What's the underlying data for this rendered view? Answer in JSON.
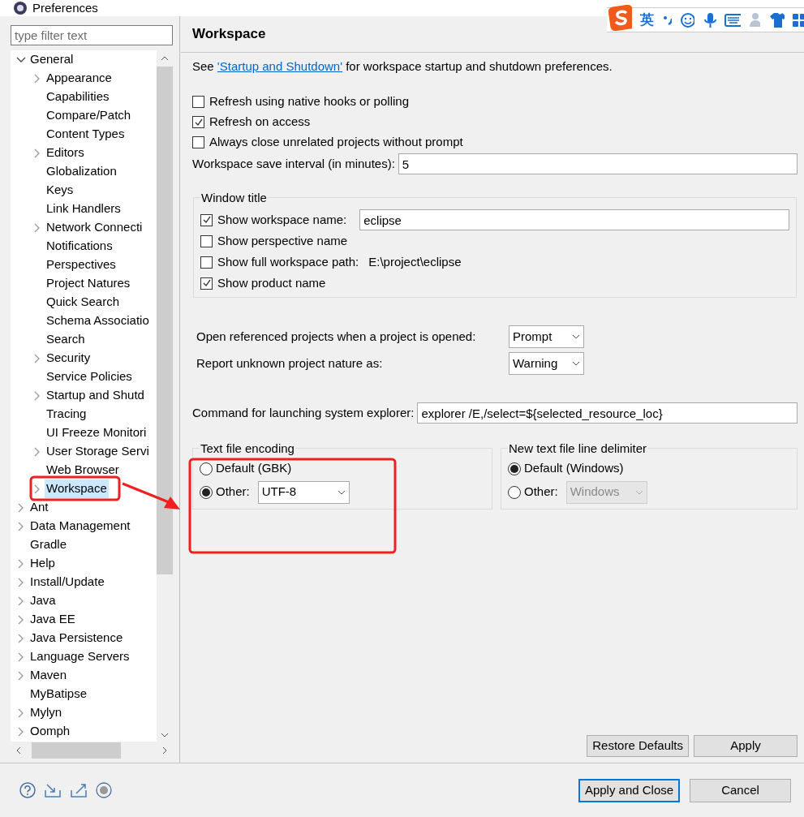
{
  "window": {
    "title": "Preferences"
  },
  "filter": {
    "placeholder": "type filter text"
  },
  "tree": [
    {
      "label": "General",
      "expandable": true,
      "expanded": true,
      "selected": false,
      "children": [
        {
          "label": "Appearance",
          "expandable": true,
          "expanded": false,
          "selected": false
        },
        {
          "label": "Capabilities",
          "expandable": false,
          "selected": false
        },
        {
          "label": "Compare/Patch",
          "expandable": false,
          "selected": false
        },
        {
          "label": "Content Types",
          "expandable": false,
          "selected": false
        },
        {
          "label": "Editors",
          "expandable": true,
          "expanded": false,
          "selected": false
        },
        {
          "label": "Globalization",
          "expandable": false,
          "selected": false
        },
        {
          "label": "Keys",
          "expandable": false,
          "selected": false
        },
        {
          "label": "Link Handlers",
          "expandable": false,
          "selected": false
        },
        {
          "label": "Network Connecti",
          "expandable": true,
          "expanded": false,
          "selected": false
        },
        {
          "label": "Notifications",
          "expandable": false,
          "selected": false
        },
        {
          "label": "Perspectives",
          "expandable": false,
          "selected": false
        },
        {
          "label": "Project Natures",
          "expandable": false,
          "selected": false
        },
        {
          "label": "Quick Search",
          "expandable": false,
          "selected": false
        },
        {
          "label": "Schema Associatio",
          "expandable": false,
          "selected": false
        },
        {
          "label": "Search",
          "expandable": false,
          "selected": false
        },
        {
          "label": "Security",
          "expandable": true,
          "expanded": false,
          "selected": false
        },
        {
          "label": "Service Policies",
          "expandable": false,
          "selected": false
        },
        {
          "label": "Startup and Shutd",
          "expandable": true,
          "expanded": false,
          "selected": false
        },
        {
          "label": "Tracing",
          "expandable": false,
          "selected": false
        },
        {
          "label": "UI Freeze Monitori",
          "expandable": false,
          "selected": false
        },
        {
          "label": "User Storage Servi",
          "expandable": true,
          "expanded": false,
          "selected": false
        },
        {
          "label": "Web Browser",
          "expandable": false,
          "selected": false
        },
        {
          "label": "Workspace",
          "expandable": true,
          "expanded": false,
          "selected": true
        }
      ]
    },
    {
      "label": "Ant",
      "expandable": true,
      "expanded": false,
      "selected": false
    },
    {
      "label": "Data Management",
      "expandable": true,
      "expanded": false,
      "selected": false
    },
    {
      "label": "Gradle",
      "expandable": false,
      "selected": false
    },
    {
      "label": "Help",
      "expandable": true,
      "expanded": false,
      "selected": false
    },
    {
      "label": "Install/Update",
      "expandable": true,
      "expanded": false,
      "selected": false
    },
    {
      "label": "Java",
      "expandable": true,
      "expanded": false,
      "selected": false
    },
    {
      "label": "Java EE",
      "expandable": true,
      "expanded": false,
      "selected": false
    },
    {
      "label": "Java Persistence",
      "expandable": true,
      "expanded": false,
      "selected": false
    },
    {
      "label": "Language Servers",
      "expandable": true,
      "expanded": false,
      "selected": false
    },
    {
      "label": "Maven",
      "expandable": true,
      "expanded": false,
      "selected": false
    },
    {
      "label": "MyBatipse",
      "expandable": false,
      "selected": false
    },
    {
      "label": "Mylyn",
      "expandable": true,
      "expanded": false,
      "selected": false
    },
    {
      "label": "Oomph",
      "expandable": true,
      "expanded": false,
      "selected": false
    }
  ],
  "page": {
    "title": "Workspace",
    "intro": {
      "before": "See",
      "link": "'Startup and Shutdown'",
      "after": "for workspace startup and shutdown preferences."
    },
    "checkboxes": [
      {
        "label": "Refresh using native hooks or polling",
        "checked": false
      },
      {
        "label": "Refresh on access",
        "checked": true
      },
      {
        "label": "Always close unrelated projects without prompt",
        "checked": false
      }
    ],
    "save_interval": {
      "label": "Workspace save interval (in minutes):",
      "value": "5"
    },
    "window_title": {
      "title": "Window title",
      "options": [
        {
          "kind": "field",
          "label": "Show workspace name:",
          "checked": true,
          "value": "eclipse"
        },
        {
          "kind": "plain",
          "label": "Show perspective name",
          "checked": false
        },
        {
          "kind": "path",
          "label": "Show full workspace path:",
          "checked": false,
          "value": "E:\\project\\eclipse"
        },
        {
          "kind": "plain",
          "label": "Show product name",
          "checked": true
        }
      ]
    },
    "dropdowns": [
      {
        "label": "Open referenced projects when a project is opened:",
        "value": "Prompt"
      },
      {
        "label": "Report unknown project nature as:",
        "value": "Warning"
      }
    ],
    "explorer": {
      "label": "Command for launching system explorer:",
      "value": "explorer /E,/select=${selected_resource_loc}"
    },
    "groups": [
      {
        "title": "Text file encoding",
        "options": [
          {
            "label": "Default (GBK)",
            "selected": false
          },
          {
            "label": "Other:",
            "selected": true,
            "value": "UTF-8",
            "disabled": false
          }
        ]
      },
      {
        "title": "New text file line delimiter",
        "options": [
          {
            "label": "Default (Windows)",
            "selected": true
          },
          {
            "label": "Other:",
            "selected": false,
            "value": "Windows",
            "disabled": true
          }
        ]
      }
    ],
    "page_buttons": [
      "Restore Defaults",
      "Apply"
    ]
  },
  "dialog_buttons": [
    {
      "label": "Apply and Close",
      "default": true
    },
    {
      "label": "Cancel",
      "default": false
    }
  ],
  "ime_bar": {
    "label": "英"
  }
}
